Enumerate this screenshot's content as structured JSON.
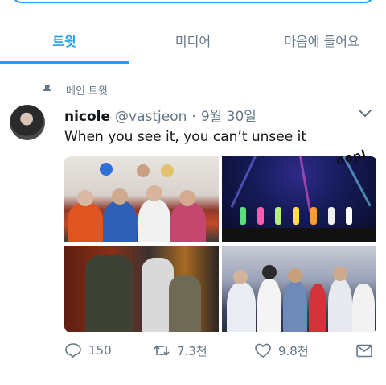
{
  "tabs": [
    {
      "label": "트윗",
      "active": true
    },
    {
      "label": "미디어",
      "active": false
    },
    {
      "label": "마음에 들어요",
      "active": false
    }
  ],
  "pinned_label": "메인 트윗",
  "tweet": {
    "name": "nicole",
    "handle": "@vastjeon",
    "separator": "·",
    "date": "9월 30일",
    "text": "When you see it, you can’t unsee it",
    "overlay_caption": "oopl"
  },
  "actions": {
    "replies": "150",
    "retweets": "7.3천",
    "likes": "9.8천"
  },
  "colors": {
    "accent": "#1da1f2",
    "text_primary": "#14171a",
    "text_secondary": "#657786",
    "border": "#e6ecf0"
  },
  "icons": [
    "pin-icon",
    "chevron-down-icon",
    "reply-icon",
    "retweet-icon",
    "like-icon",
    "message-icon"
  ]
}
